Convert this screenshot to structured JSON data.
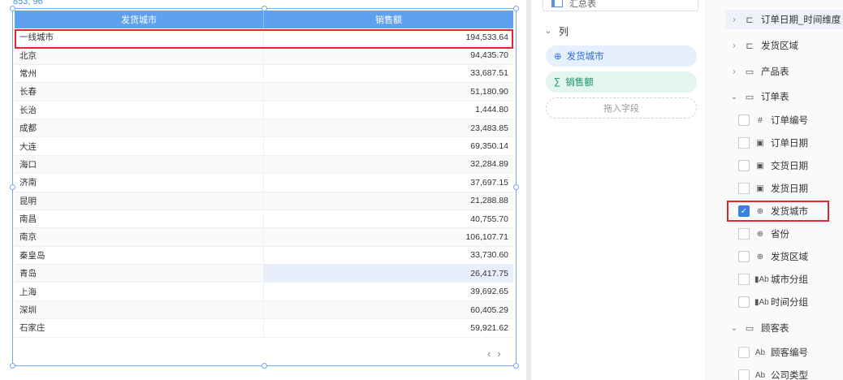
{
  "canvas": {
    "coord_readout": "853, 96",
    "table": {
      "headers": [
        "发货城市",
        "销售额"
      ],
      "rows": [
        [
          "一线城市",
          "194,533.64"
        ],
        [
          "北京",
          "94,435.70"
        ],
        [
          "常州",
          "33,687.51"
        ],
        [
          "长春",
          "51,180.90"
        ],
        [
          "长治",
          "1,444.80"
        ],
        [
          "成都",
          "23,483.85"
        ],
        [
          "大连",
          "69,350.14"
        ],
        [
          "海口",
          "32,284.89"
        ],
        [
          "济南",
          "37,697.15"
        ],
        [
          "昆明",
          "21,288.88"
        ],
        [
          "南昌",
          "40,755.70"
        ],
        [
          "南京",
          "106,107.71"
        ],
        [
          "秦皇岛",
          "33,730.60"
        ],
        [
          "青岛",
          "26,417.75"
        ],
        [
          "上海",
          "39,692.65"
        ],
        [
          "深圳",
          "60,405.29"
        ],
        [
          "石家庄",
          "59,921.62"
        ]
      ]
    },
    "pager": {
      "prev": "‹",
      "next": "›"
    }
  },
  "mid": {
    "summary_label": "汇总表",
    "columns_label": "列",
    "fields": [
      {
        "label": "发货城市",
        "icon": "globe-icon"
      },
      {
        "label": "销售额",
        "icon": "sigma-icon"
      }
    ],
    "drop_hint": "拖入字段"
  },
  "right": {
    "items": [
      {
        "label": "订单日期_时间维度",
        "icon": "hierarchy-icon",
        "type": "group"
      },
      {
        "label": "发货区域",
        "icon": "hierarchy-icon",
        "type": "group"
      },
      {
        "label": "产品表",
        "icon": "folder-icon",
        "type": "group"
      },
      {
        "label": "订单表",
        "icon": "folder-check-icon",
        "type": "group-open"
      }
    ],
    "order_fields": [
      {
        "label": "订单编号",
        "icon": "#",
        "checked": false
      },
      {
        "label": "订单日期",
        "icon": "▣",
        "checked": false
      },
      {
        "label": "交货日期",
        "icon": "▣",
        "checked": false
      },
      {
        "label": "发货日期",
        "icon": "▣",
        "checked": false
      },
      {
        "label": "发货城市",
        "icon": "⊕",
        "checked": true
      },
      {
        "label": "省份",
        "icon": "⊕",
        "checked": false
      },
      {
        "label": "发货区域",
        "icon": "⊕",
        "checked": false
      },
      {
        "label": "城市分组",
        "icon": "▮Ab",
        "checked": false
      },
      {
        "label": "时间分组",
        "icon": "▮Ab",
        "checked": false
      }
    ],
    "customer_group": "顾客表",
    "customer_fields": [
      {
        "label": "顾客编号",
        "icon": "Ab",
        "checked": false
      },
      {
        "label": "公司类型",
        "icon": "Ab",
        "checked": false
      }
    ]
  },
  "colors": {
    "accent": "#5fa0ef",
    "highlight": "#e0262b",
    "check": "#3d7ee6"
  }
}
